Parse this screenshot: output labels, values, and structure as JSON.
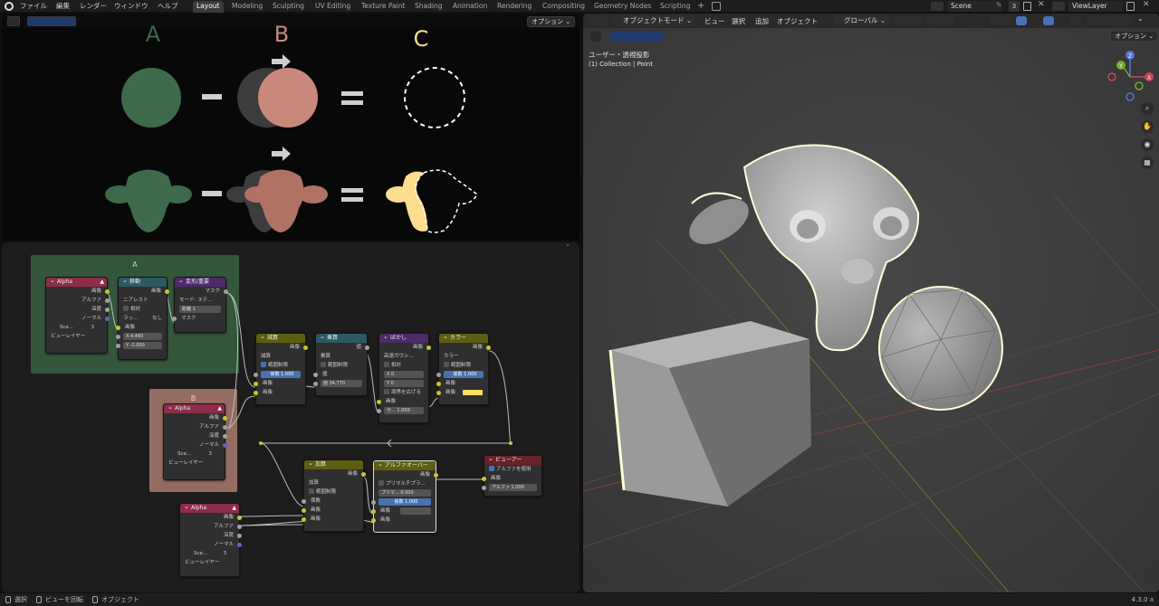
{
  "app": {
    "version": "4.3.0 a"
  },
  "menu": [
    "ファイル",
    "編集",
    "レンダー",
    "ウィンドウ",
    "ヘルプ"
  ],
  "workspaces": [
    "Layout",
    "Modeling",
    "Sculpting",
    "UV Editing",
    "Texture Paint",
    "Shading",
    "Animation",
    "Rendering",
    "Compositing",
    "Geometry Nodes",
    "Scripting"
  ],
  "active_workspace": "Layout",
  "scene": {
    "label": "Scene",
    "count": "3",
    "view_layer": "ViewLayer"
  },
  "image_editor": {
    "options_label": "オプション ⌄",
    "letters": [
      "A",
      "B",
      "C"
    ],
    "colors": {
      "green": "#3e6a4c",
      "salmon": "#c8897a",
      "yellow": "#ffdd90",
      "dark": "#3c3c3c"
    }
  },
  "compositor": {
    "frames": {
      "A": "A",
      "B": "B"
    },
    "alpha_node": {
      "title": "Alpha",
      "outputs": [
        "画像",
        "アルファ",
        "深度",
        "ノーマル"
      ],
      "scene": "Sce...",
      "num": "3",
      "layer": "ビューレイヤー"
    },
    "move_node": {
      "title": "移動",
      "interp": "ニアレスト",
      "relative": "相対",
      "wrap_label": "ラッ...",
      "wrap_value": "なし",
      "image": "画像",
      "x": "X  4.460",
      "y": "Y  -2.000"
    },
    "transform_node": {
      "title": "変形/重要",
      "out": "マスク",
      "mode_label": "モード:",
      "mode_value": "ステ...",
      "iterations": "距離  1",
      "mask": "マスク"
    },
    "subtract_node": {
      "title": "減算",
      "out": "画像",
      "op": "減算",
      "clamp": "範囲制限",
      "factor": "係数  1.000",
      "in1": "画像",
      "in2": "画像"
    },
    "multiply_node": {
      "title": "乗算",
      "out": "値",
      "op": "乗算",
      "clamp": "範囲制限",
      "value": "値  34.770",
      "in": "値"
    },
    "blur_node": {
      "title": "ぼかし",
      "out": "画像",
      "type": "高速ガウシ...",
      "relative": "相対",
      "x": "X   0",
      "y": "Y   0",
      "extend": "境界を広げる",
      "image": "画像",
      "size": "サ...  1.000"
    },
    "color_node": {
      "title": "カラー",
      "out": "画像",
      "mode": "カラー",
      "clamp": "範囲制限",
      "factor": "係数  1.000",
      "image": "画像",
      "in": "画像"
    },
    "add_node": {
      "title": "加算",
      "out": "画像",
      "op": "加算",
      "clamp": "範囲制限",
      "factor": "係数",
      "in1": "画像",
      "in2": "画像"
    },
    "alphaover_node": {
      "title": "アルファオーバー",
      "out": "画像",
      "premult": "プリマルチプラ...",
      "premult_val": "プリマ...  0.000",
      "factor": "係数  1.000",
      "in1": "画像",
      "in2": "画像"
    },
    "viewer_node": {
      "title": "ビューアー",
      "use_alpha": "アルファを使用",
      "image": "画像",
      "alpha": "アルファ  1.000"
    }
  },
  "viewport": {
    "mode": "オブジェクトモード",
    "menus": [
      "ビュー",
      "選択",
      "追加",
      "オブジェクト"
    ],
    "transform": "グローバル",
    "options_label": "オプション ⌄",
    "view_name": "ユーザー・透視投影",
    "collection": "(1) Collection | Point"
  },
  "status": {
    "select": "選択",
    "rotate": "ビューを回転",
    "object": "オブジェクト"
  }
}
